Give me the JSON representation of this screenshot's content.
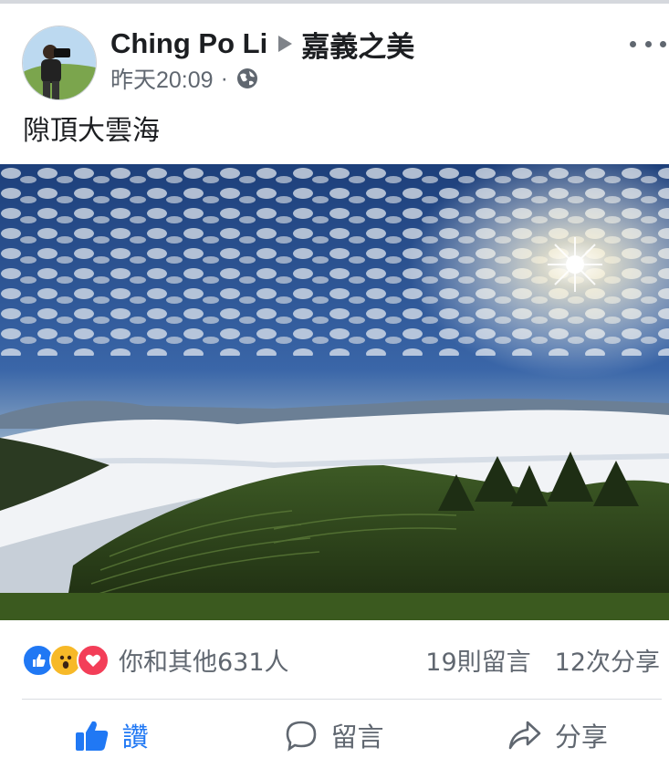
{
  "post": {
    "author": "Ching Po Li",
    "group": "嘉義之美",
    "time": "昨天20:09",
    "separator": "·",
    "privacy_icon": "globe-icon",
    "text": "隙頂大雲海"
  },
  "reactions": {
    "types": [
      "like",
      "wow",
      "love"
    ],
    "summary": "你和其他631人"
  },
  "counts": {
    "comments": "19則留言",
    "shares": "12次分享"
  },
  "actions": {
    "like": "讚",
    "comment": "留言",
    "share": "分享"
  },
  "colors": {
    "accent": "#2078f4",
    "secondary_text": "#606770",
    "love": "#f33e58",
    "wow": "#f7b928"
  }
}
